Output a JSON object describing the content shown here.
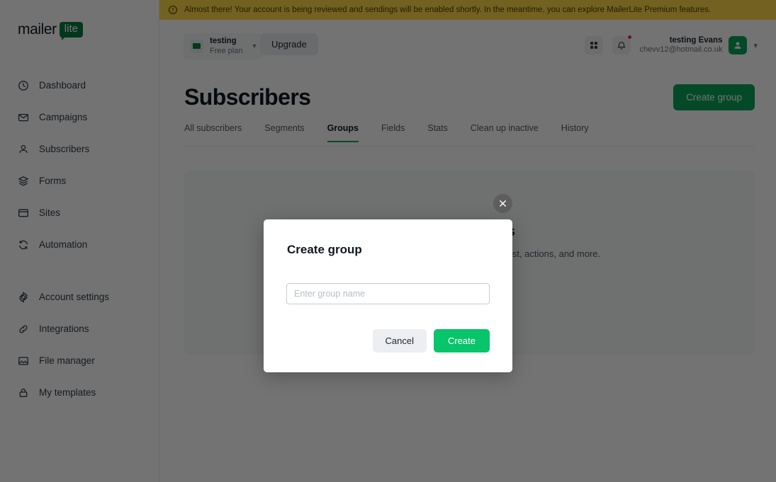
{
  "banner": {
    "icon": "info-circle-icon",
    "text": "Almost there! Your account is being reviewed and sendings will be enabled shortly. In the meantime, you can explore MailerLite Premium features.",
    "background": "#ffd74b",
    "text_color": "#5a3d00"
  },
  "brand": {
    "name_primary": "mailer",
    "name_secondary": "lite",
    "green": "#0b7a3e",
    "accent_green": "#0aa55a",
    "bright_green": "#08c46a"
  },
  "sidebar": {
    "groups": [
      {
        "items": [
          {
            "label": "Dashboard",
            "icon": "clock-icon"
          },
          {
            "label": "Campaigns",
            "icon": "envelope-icon"
          },
          {
            "label": "Subscribers",
            "icon": "person-icon"
          },
          {
            "label": "Forms",
            "icon": "layers-icon"
          },
          {
            "label": "Sites",
            "icon": "window-icon"
          },
          {
            "label": "Automation",
            "icon": "refresh-icon"
          }
        ]
      },
      {
        "items": [
          {
            "label": "Account settings",
            "icon": "gear-icon"
          },
          {
            "label": "Integrations",
            "icon": "link-icon"
          },
          {
            "label": "File manager",
            "icon": "image-icon"
          },
          {
            "label": "My templates",
            "icon": "lock-icon"
          }
        ]
      }
    ]
  },
  "topbar": {
    "account": {
      "name": "testing",
      "plan": "Free plan",
      "flag_icon": "flag-icon",
      "caret_icon": "chevron-down-icon"
    },
    "upgrade_label": "Upgrade",
    "apps_icon": "grid-icon",
    "notifications_icon": "bell-icon",
    "notifications_has_badge": true,
    "user": {
      "name": "testing Evans",
      "email": "chevv12@hotmail.co.uk",
      "avatar_icon": "user-icon",
      "caret_icon": "chevron-down-icon"
    }
  },
  "main": {
    "title": "Subscribers",
    "primary_action": "Create group",
    "tabs": [
      {
        "label": "All subscribers",
        "active": false
      },
      {
        "label": "Segments",
        "active": false
      },
      {
        "label": "Groups",
        "active": true
      },
      {
        "label": "Fields",
        "active": false
      },
      {
        "label": "Stats",
        "active": false
      },
      {
        "label": "Clean up inactive",
        "active": false
      },
      {
        "label": "History",
        "active": false
      }
    ],
    "empty_state": {
      "title": "Create groups",
      "subtitle": "Organize your subscribers based on interest, actions, and more."
    }
  },
  "modal": {
    "title": "Create group",
    "input_value": "",
    "input_placeholder": "Enter group name",
    "cancel_label": "Cancel",
    "create_label": "Create",
    "close_icon": "close-icon"
  }
}
